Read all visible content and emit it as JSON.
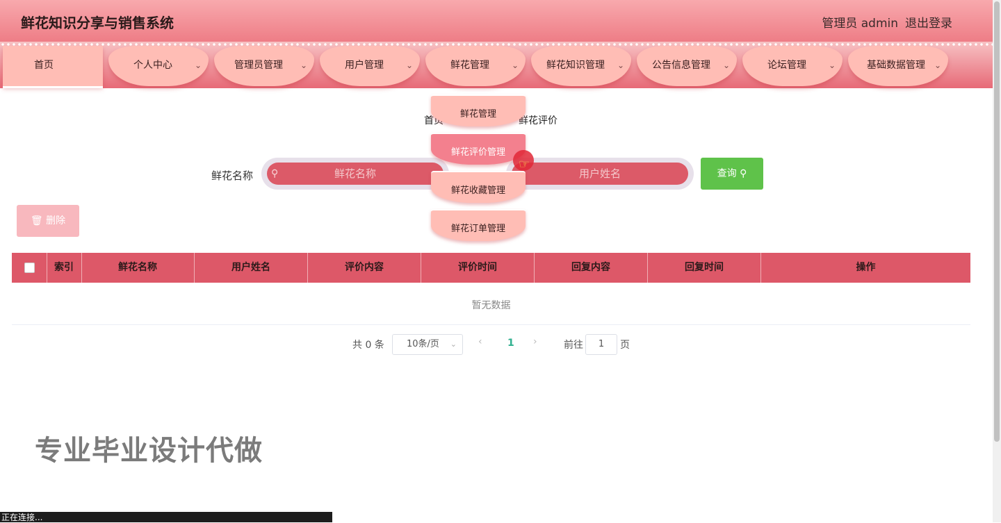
{
  "header": {
    "title": "鲜花知识分享与销售系统",
    "user": "管理员 admin",
    "logout": "退出登录"
  },
  "nav": {
    "items": [
      {
        "label": "首页",
        "dropdown": false
      },
      {
        "label": "个人中心",
        "dropdown": true
      },
      {
        "label": "管理员管理",
        "dropdown": true
      },
      {
        "label": "用户管理",
        "dropdown": true
      },
      {
        "label": "鲜花管理",
        "dropdown": true
      },
      {
        "label": "鲜花知识管理",
        "dropdown": true
      },
      {
        "label": "公告信息管理",
        "dropdown": true
      },
      {
        "label": "论坛管理",
        "dropdown": true
      },
      {
        "label": "基础数据管理",
        "dropdown": true
      }
    ]
  },
  "dropdown": {
    "items": [
      "鲜花管理",
      "鲜花评价管理",
      "鲜花收藏管理",
      "鲜花订单管理"
    ],
    "hovered": "鲜花评价管理"
  },
  "breadcrumb": {
    "home": "首页",
    "current": "鲜花评价"
  },
  "search": {
    "label": "鲜花名称",
    "flower_placeholder": "鲜花名称",
    "user_placeholder": "用户姓名",
    "query_button": "查询"
  },
  "toolbar": {
    "delete_button": "删除"
  },
  "table": {
    "columns": [
      "索引",
      "鲜花名称",
      "用户姓名",
      "评价内容",
      "评价时间",
      "回复内容",
      "回复时间",
      "操作"
    ],
    "rows": [],
    "empty_text": "暂无数据"
  },
  "pagination": {
    "total": "共 0 条",
    "page_size": "10条/页",
    "current_page": "1",
    "goto_label": "前往",
    "goto_value": "1",
    "page_suffix": "页"
  },
  "watermark": "专业毕业设计代做",
  "status_bar": "正在连接..."
}
